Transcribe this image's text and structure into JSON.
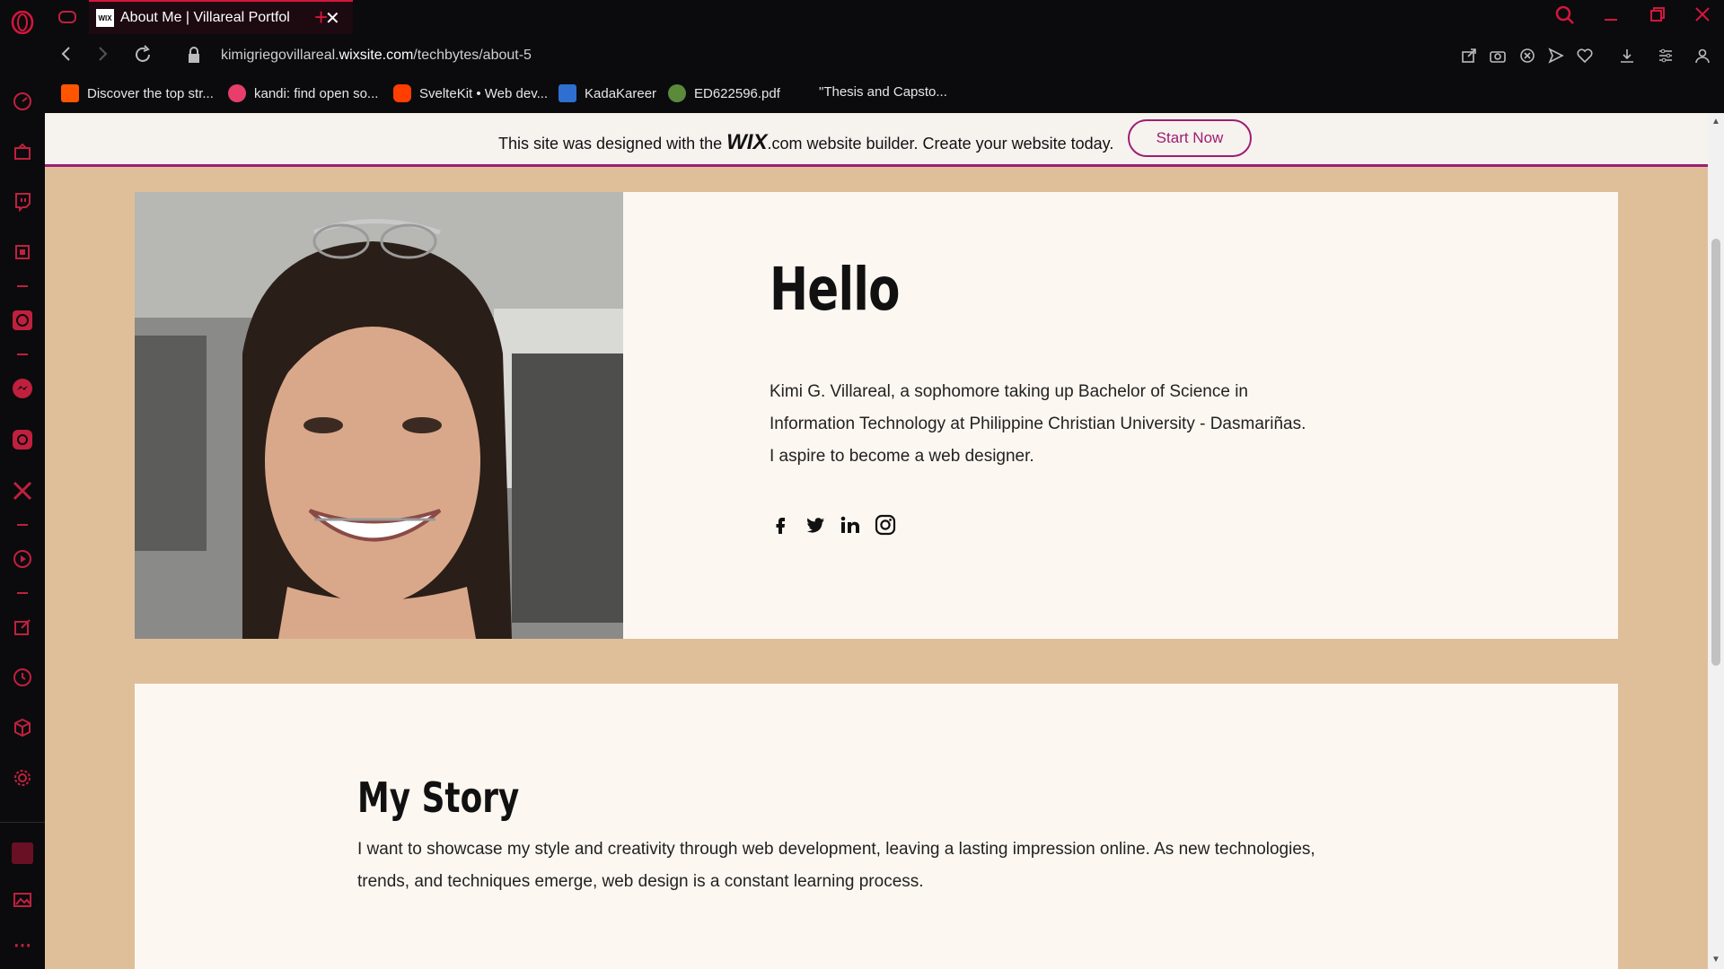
{
  "browser": {
    "tab_title": "About Me | Villareal Portfol",
    "favicon_text": "WIX",
    "url_prefix": "kimigriegovillareal.",
    "url_domain": "wixsite.com",
    "url_path": "/techbytes/about-5",
    "accent_color": "#d4163d"
  },
  "bookmarks": [
    {
      "label": "Discover the top str...",
      "icon": "soundcloud-icon",
      "color": "#ff5500"
    },
    {
      "label": "kandi: find open so...",
      "icon": "kandi-icon",
      "color": "#e83e6b"
    },
    {
      "label": "SvelteKit • Web dev...",
      "icon": "svelte-icon",
      "color": "#ff3e00"
    },
    {
      "label": "KadaKareer",
      "icon": "kadakareer-icon",
      "color": "#2f6fd0"
    },
    {
      "label": "ED622596.pdf",
      "icon": "eric-icon",
      "color": "#5a8a3a"
    },
    {
      "label": "\"Thesis and Capsto...",
      "icon": "",
      "color": ""
    }
  ],
  "wix_banner": {
    "text_before": "This site was designed with the ",
    "logo": "WIX",
    "logo_suffix": ".com",
    "text_after": " website builder. Create your website today.",
    "button": "Start Now",
    "accent_color": "#9e1e74"
  },
  "hero": {
    "heading": "Hello",
    "bio_lines": [
      "Kimi G. Villareal, a sophomore taking up Bachelor of Science in",
      "Information Technology at Philippine Christian University - Dasmariñas.",
      "I aspire to become a web designer."
    ],
    "social_icons": [
      "facebook-icon",
      "twitter-icon",
      "linkedin-icon",
      "instagram-icon"
    ],
    "background": "#dfbf9a"
  },
  "story": {
    "heading": "My Story",
    "lines": [
      "I want to showcase my style and creativity through web development, leaving a lasting impression online. As new technologies,",
      "trends, and techniques emerge, web design is a constant learning process."
    ]
  }
}
